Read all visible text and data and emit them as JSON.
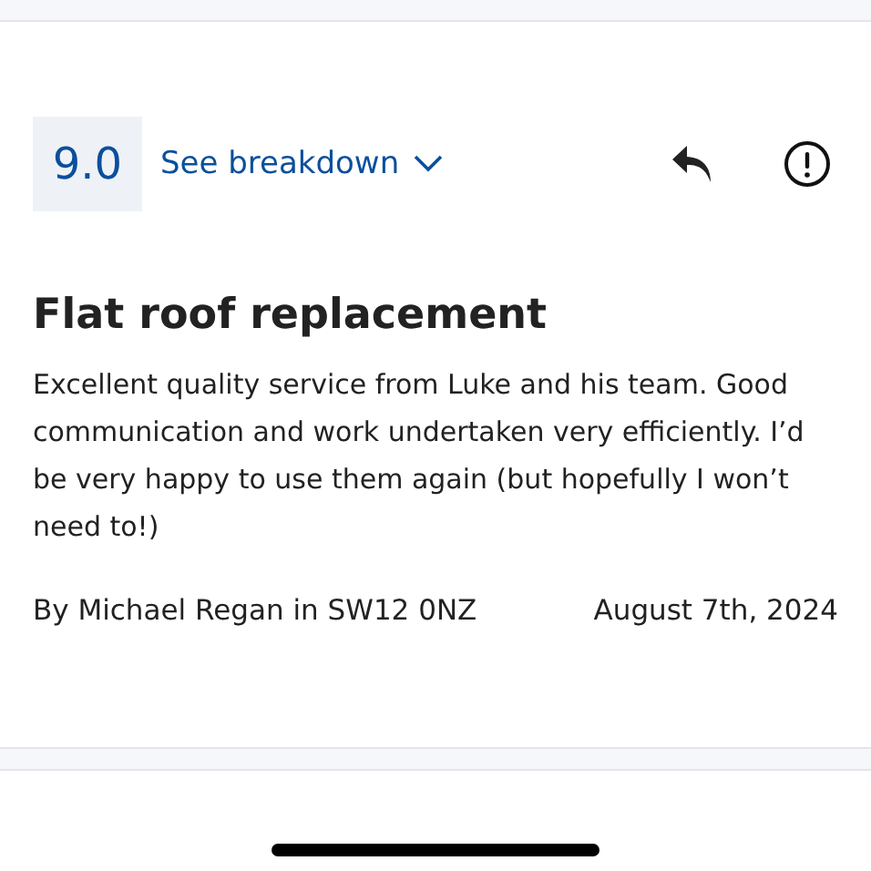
{
  "review": {
    "score": "9.0",
    "breakdown_link": "See breakdown",
    "title": "Flat roof replacement",
    "body": "Excellent quality service from Luke and his team. Good communication and work undertaken very efficiently. I’d be very happy to use them again (but hopefully I won’t need to!)",
    "author": "By Michael Regan in SW12 0NZ",
    "date": "August 7th, 2024"
  }
}
